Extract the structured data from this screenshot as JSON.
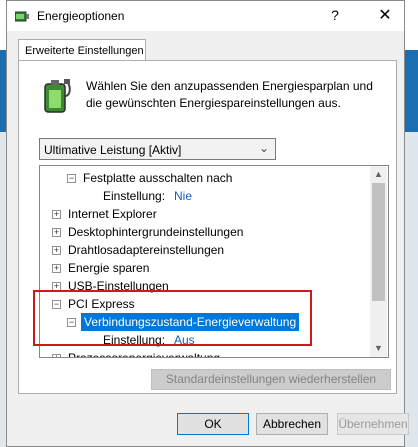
{
  "window": {
    "title": "Energieoptionen",
    "help_glyph": "?",
    "close_glyph": "✕"
  },
  "tab": {
    "label": "Erweiterte Einstellungen"
  },
  "intro": "Wählen Sie den anzupassenden Energiesparplan und die gewünschten Energiespareinstellungen aus.",
  "plan_select": {
    "value": "Ultimative Leistung [Aktiv]"
  },
  "tree": {
    "items": [
      {
        "label": "Festplatte ausschalten nach",
        "expander": "−"
      },
      {
        "label": "Einstellung:",
        "value": "Nie"
      },
      {
        "label": "Internet Explorer",
        "expander": "+"
      },
      {
        "label": "Desktophintergrundeinstellungen",
        "expander": "+"
      },
      {
        "label": "Drahtlosadaptereinstellungen",
        "expander": "+"
      },
      {
        "label": "Energie sparen",
        "expander": "+"
      },
      {
        "label": "USB-Einstellungen",
        "expander": "+"
      },
      {
        "label": "PCI Express",
        "expander": "−"
      },
      {
        "label": "Verbindungszustand-Energieverwaltung",
        "expander": "−"
      },
      {
        "label": "Einstellung:",
        "value": "Aus"
      },
      {
        "label": "Prozessorenergieverwaltung",
        "expander": "+"
      }
    ]
  },
  "buttons": {
    "restore": "Standardeinstellungen wiederherstellen",
    "ok": "OK",
    "cancel": "Abbrechen",
    "apply": "Übernehmen"
  },
  "colors": {
    "selection": "#0078d7",
    "value_link": "#1a5fb4",
    "annotation": "#cc1a1a"
  }
}
